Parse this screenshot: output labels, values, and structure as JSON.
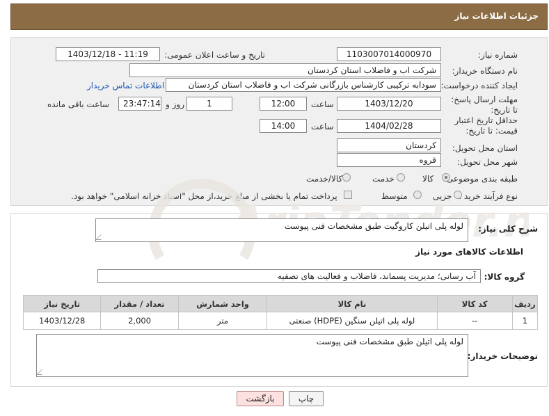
{
  "header": {
    "title": "جزئیات اطلاعات نیاز"
  },
  "form": {
    "need_number_label": "شماره نیاز:",
    "need_number": "1103007014000970",
    "announce_label": "تاریخ و ساعت اعلان عمومی:",
    "announce_value": "1403/12/18 - 11:19",
    "buyer_label": "نام دستگاه خریدار:",
    "buyer_value": "شرکت اب و فاضلاب استان کردستان",
    "creator_label": "ایجاد کننده درخواست:",
    "creator_value": "سودابه ترکیبی کارشناس بازرگانی شرکت اب و فاضلاب استان کردستان",
    "contact_link": "اطلاعات تماس خریدار",
    "reply_deadline_label": "مهلت ارسال پاسخ: تا تاریخ:",
    "reply_date": "1403/12/20",
    "time_label": "ساعت",
    "reply_time": "12:00",
    "days_value": "1",
    "days_label": "روز و",
    "remaining_value": "23:47:14",
    "remaining_label": "ساعت باقی مانده",
    "validity_label": "حداقل تاریخ اعتبار قیمت: تا تاریخ:",
    "validity_date": "1404/02/28",
    "validity_time": "14:00",
    "province_label": "استان محل تحویل:",
    "province_value": "کردستان",
    "city_label": "شهر محل تحویل:",
    "city_value": "قروه",
    "category_label": "طبقه بندی موضوعی:",
    "category_options": [
      "کالا",
      "خدمت",
      "کالا/خدمت"
    ],
    "category_selected": "کالا",
    "process_label": "نوع فرآیند خرید :",
    "process_options": [
      "جزیی",
      "متوسط"
    ],
    "payment_note": "پرداخت تمام یا بخشی از مبلغ خرید،از محل \"اسناد خزانه اسلامی\" خواهد بود."
  },
  "details": {
    "summary_label": "شرح کلی نیاز:",
    "summary_value": "لوله پلی اتیلن کاروگیت طبق مشخصات فنی پیوست",
    "goods_info_title": "اطلاعات کالاهای مورد نیاز",
    "group_label": "گروه کالا:",
    "group_value": "آب رسانی؛ مدیریت پسماند، فاضلاب و فعالیت های تصفیه",
    "table": {
      "headers": [
        "ردیف",
        "کد کالا",
        "نام کالا",
        "واحد شمارش",
        "تعداد / مقدار",
        "تاریخ نیاز"
      ],
      "rows": [
        [
          "1",
          "--",
          "لوله پلی اتیلن سنگین (HDPE) صنعتی",
          "متر",
          "2,000",
          "1403/12/28"
        ]
      ]
    },
    "buyer_notes_label": "توضیحات خریدار:",
    "buyer_notes_value": "لوله پلی اتیلن طبق مشخصات فنی پیوست"
  },
  "buttons": {
    "print": "چاپ",
    "back": "بازگشت"
  },
  "colors": {
    "header_bg": "#8c6c45",
    "link": "#1a56b0",
    "back_bg": "#fde0e0"
  }
}
